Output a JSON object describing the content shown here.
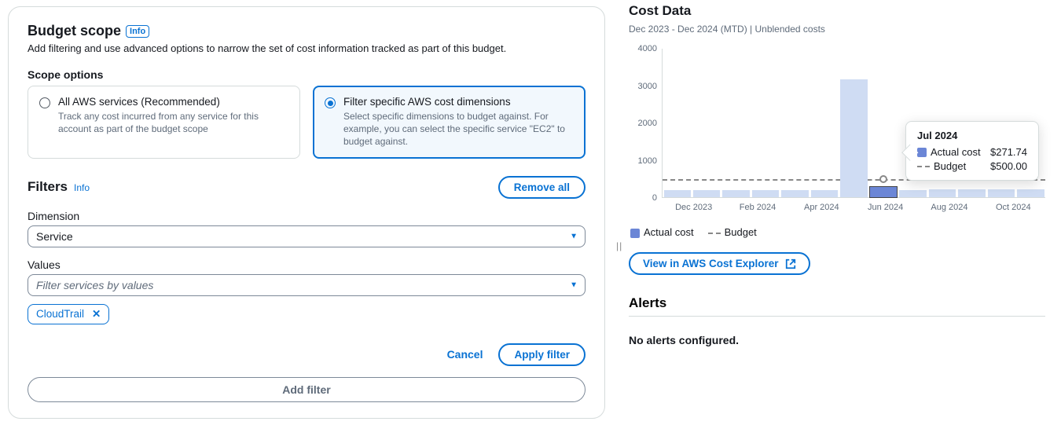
{
  "left": {
    "title": "Budget scope",
    "info_badge": "Info",
    "subtitle": "Add filtering and use advanced options to narrow the set of cost information tracked as part of this budget.",
    "scope_label": "Scope options",
    "scope": [
      {
        "title": "All AWS services (Recommended)",
        "desc": "Track any cost incurred from any service for this account as part of the budget scope",
        "selected": false
      },
      {
        "title": "Filter specific AWS cost dimensions",
        "desc": "Select specific dimensions to budget against. For example, you can select the specific service \"EC2\" to budget against.",
        "selected": true
      }
    ],
    "filters_title": "Filters",
    "filters_info": "Info",
    "remove_all": "Remove all",
    "dimension_label": "Dimension",
    "dimension_value": "Service",
    "values_label": "Values",
    "values_placeholder": "Filter services by values",
    "tag_value": "CloudTrail",
    "cancel": "Cancel",
    "apply": "Apply filter",
    "add_filter": "Add filter"
  },
  "right": {
    "title": "Cost Data",
    "subtitle": "Dec 2023 - Dec 2024 (MTD) | Unblended costs",
    "view_btn": "View in AWS Cost Explorer",
    "legend_actual": "Actual cost",
    "legend_budget": "Budget",
    "alerts_title": "Alerts",
    "alerts_empty": "No alerts configured.",
    "tooltip": {
      "month": "Jul 2024",
      "actual_label": "Actual cost",
      "actual_value": "$271.74",
      "budget_label": "Budget",
      "budget_value": "$500.00"
    }
  },
  "chart_data": {
    "type": "bar",
    "title": "Cost Data",
    "xlabel": "",
    "ylabel": "",
    "ylim": [
      0,
      4000
    ],
    "yticks": [
      0,
      1000,
      2000,
      3000,
      4000
    ],
    "categories": [
      "Dec 2023",
      "Jan 2024",
      "Feb 2024",
      "Mar 2024",
      "Apr 2024",
      "May 2024",
      "Jun 2024",
      "Jul 2024",
      "Aug 2024",
      "Sep 2024",
      "Oct 2024",
      "Nov 2024",
      "Dec 2024"
    ],
    "x_tick_labels": [
      "Dec 2023",
      "Feb 2024",
      "Apr 2024",
      "Jun 2024",
      "Aug 2024",
      "Oct 2024"
    ],
    "series": [
      {
        "name": "Actual cost",
        "values": [
          180,
          190,
          180,
          190,
          200,
          200,
          3150,
          271.74,
          200,
          210,
          210,
          210,
          210
        ],
        "color": "#cfdcf3"
      },
      {
        "name": "Budget",
        "values": [
          500,
          500,
          500,
          500,
          500,
          500,
          500,
          500,
          500,
          500,
          500,
          500,
          500
        ],
        "style": "dashed",
        "color": "#888"
      }
    ],
    "highlight_index": 7
  }
}
